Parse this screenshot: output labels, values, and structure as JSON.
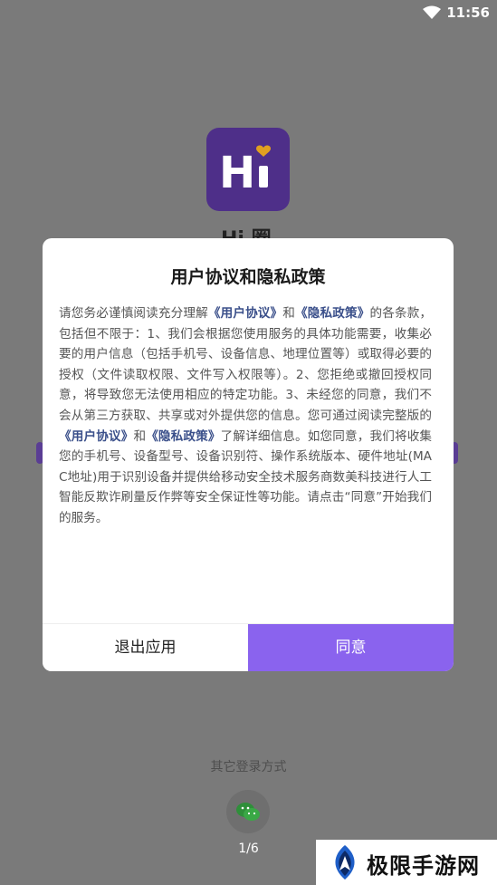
{
  "status_bar": {
    "time": "11:56",
    "wifi_icon": "wifi-icon"
  },
  "app": {
    "logo_text": "Hi",
    "name": "Hi 圈"
  },
  "dialog": {
    "title": "用户协议和隐私政策",
    "body": {
      "p1_prefix": "请您务必谨慎阅读充分理解",
      "link_user_agreement": "《用户协议》",
      "and1": "和",
      "link_privacy_policy": "《隐私政策》",
      "p1_rest": "的各条款，包括但不限于：1、我们会根据您使用服务的具体功能需要，收集必要的用户信息（包括手机号、设备信息、地理位置等）或取得必要的授权（文件读取权限、文件写入权限等）。2、您拒绝或撤回授权同意，将导致您无法使用相应的特定功能。3、未经您的同意，我们不会从第三方获取、共享或对外提供您的信息。您可通过阅读完整版的",
      "link_user_agreement_2": "《用户协议》",
      "and2": "和",
      "link_privacy_policy_2": "《隐私政策》",
      "p1_end": "了解详细信息。如您同意，我们将收集您的手机号、设备型号、设备识别符、操作系统版本、硬件地址(MAC地址)用于识别设备并提供给移动安全技术服务商数美科技进行人工智能反欺诈刷量反作弊等安全保证性等功能。请点击“同意”开始我们的服务。"
    },
    "exit_label": "退出应用",
    "agree_label": "同意"
  },
  "other_login": {
    "label": "其它登录方式",
    "wechat_icon": "wechat-icon"
  },
  "page_indicator": "1/6",
  "watermark": {
    "text": "极限手游网"
  },
  "colors": {
    "accent": "#8a63ee",
    "logo_bg": "#4e2f89",
    "link": "#3a4f8a"
  }
}
